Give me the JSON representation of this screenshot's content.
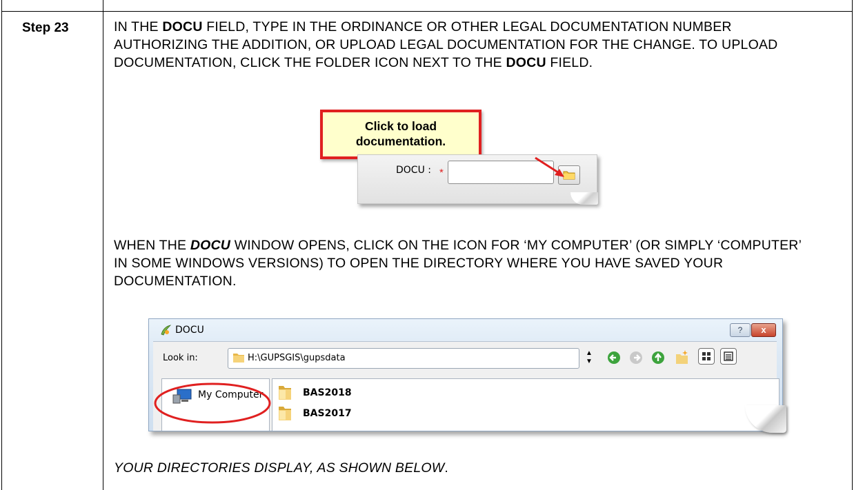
{
  "step": {
    "label": "Step 23"
  },
  "para1": {
    "a": "IN THE ",
    "b": "DOCU",
    "c": " FIELD, TYPE IN THE ORDINANCE OR OTHER LEGAL DOCUMENTATION NUMBER AUTHORIZING THE ADDITION, OR UPLOAD LEGAL DOCUMENTATION FOR THE CHANGE. TO UPLOAD DOCUMENTATION, CLICK THE FOLDER ICON NEXT TO THE ",
    "d": "DOCU",
    "e": " FIELD."
  },
  "callout": {
    "text": "Click to load documentation."
  },
  "docu_field": {
    "label": "DOCU :",
    "required_mark": "*",
    "value": ""
  },
  "para2": {
    "a": "WHEN THE ",
    "b": "DOCU",
    "c": " WINDOW OPENS, CLICK ON THE ICON FOR ‘MY COMPUTER’ (OR SIMPLY ‘COMPUTER’ IN SOME WINDOWS VERSIONS) TO OPEN THE DIRECTORY WHERE YOU HAVE SAVED YOUR DOCUMENTATION."
  },
  "window": {
    "title": "DOCU",
    "help_label": "?",
    "close_label": "x",
    "look_in_label": "Look in:",
    "path": "H:\\GUPSGIS\\gupsdata",
    "sidebar": [
      {
        "label": "My Computer",
        "icon": "computer-icon"
      }
    ],
    "files": [
      {
        "name": "BAS2018",
        "icon": "folder-icon"
      },
      {
        "name": "BAS2017",
        "icon": "folder-icon"
      }
    ]
  },
  "para3": {
    "text": "YOUR DIRECTORIES DISPLAY, AS SHOWN BELOW",
    "suffix": "."
  },
  "colors": {
    "callout_border": "#e02020",
    "callout_fill": "#ffffcc",
    "highlight_ring": "#e02020"
  }
}
